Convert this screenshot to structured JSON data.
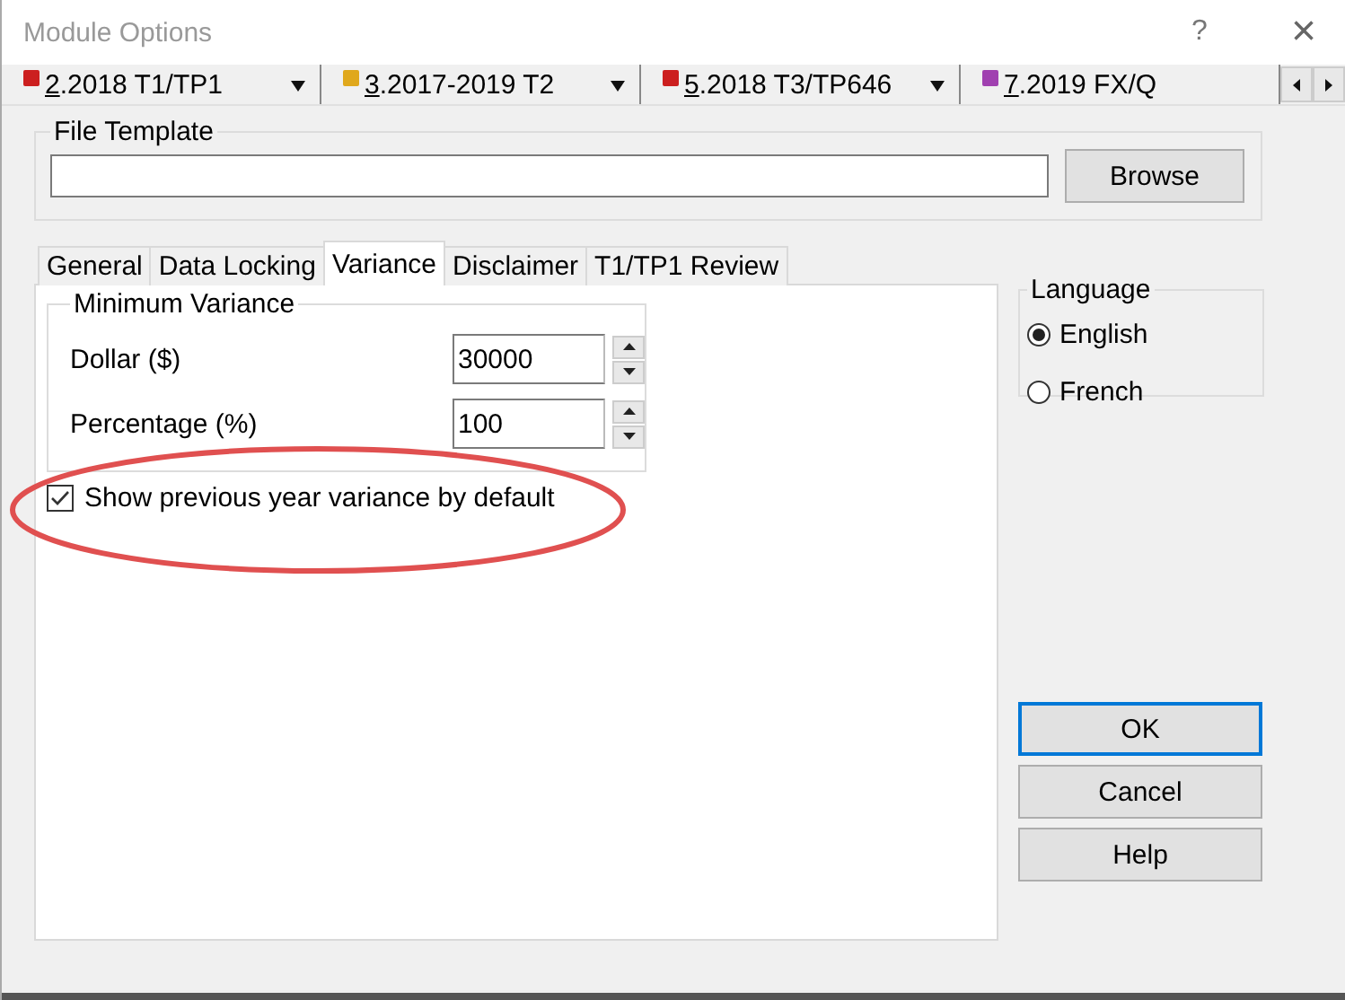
{
  "window": {
    "title": "Module Options",
    "help": "?",
    "close": "×"
  },
  "modules": [
    {
      "key": "2",
      "label": ".2018 T1/TP1",
      "color": "#cc1f1f"
    },
    {
      "key": "3",
      "label": ".2017-2019 T2",
      "color": "#e0a81c"
    },
    {
      "key": "5",
      "label": ".2018 T3/TP646",
      "color": "#cc1f1f"
    },
    {
      "key": "7",
      "label": ".2019 FX/Q",
      "color": "#a040b0"
    }
  ],
  "file_template": {
    "legend": "File Template",
    "browse": "Browse"
  },
  "tabs": [
    {
      "label": "General",
      "selected": false
    },
    {
      "label": "Data Locking",
      "selected": false
    },
    {
      "label": "Variance",
      "selected": true
    },
    {
      "label": "Disclaimer",
      "selected": false
    },
    {
      "label": "T1/TP1 Review",
      "selected": false
    }
  ],
  "minimum_variance": {
    "legend": "Minimum Variance",
    "fields": [
      {
        "label": "Dollar ($)",
        "value": "30000"
      },
      {
        "label": "Percentage (%)",
        "value": "100"
      }
    ]
  },
  "show_previous": {
    "label": "Show previous year variance by default",
    "checked": true
  },
  "language": {
    "legend": "Language",
    "options": [
      {
        "label": "English",
        "selected": true
      },
      {
        "label": "French",
        "selected": false
      }
    ]
  },
  "buttons": [
    {
      "label": "OK",
      "default": true
    },
    {
      "label": "Cancel",
      "default": false
    },
    {
      "label": "Help",
      "default": false
    }
  ]
}
